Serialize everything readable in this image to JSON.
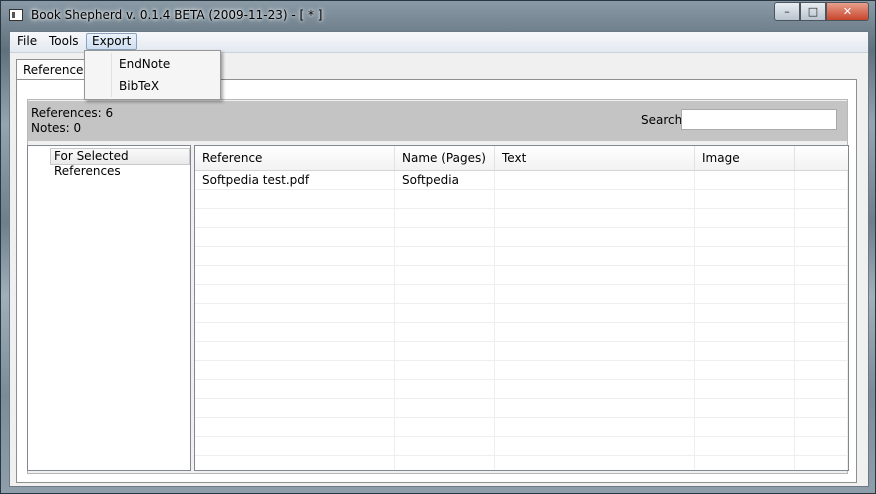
{
  "window": {
    "title": "Book Shepherd v. 0.1.4 BETA (2009-11-23) - [  * ]",
    "caption": {
      "minimize": "–",
      "maximize": "□",
      "close": "✕"
    }
  },
  "menu": {
    "file": "File",
    "tools": "Tools",
    "export": "Export"
  },
  "export_menu": {
    "items": [
      "EndNote",
      "BibTeX"
    ]
  },
  "tabs": {
    "references": "References"
  },
  "stats": {
    "references": "References: 6",
    "notes": "Notes: 0"
  },
  "search": {
    "label": "Search",
    "value": ""
  },
  "left_pane": {
    "button": "For Selected References"
  },
  "table": {
    "columns": [
      "Reference",
      "Name (Pages)",
      "Text",
      "Image"
    ],
    "rows": [
      [
        "Softpedia test.pdf",
        "Softpedia",
        "",
        ""
      ]
    ]
  }
}
